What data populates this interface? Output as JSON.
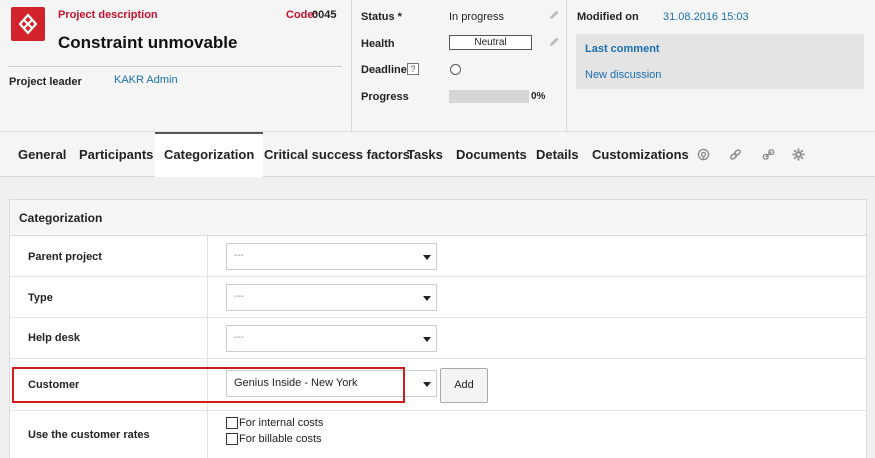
{
  "project": {
    "description_label": "Project description",
    "code_label": "Code:",
    "code_value": "0045",
    "title": "Constraint unmovable",
    "leader_label": "Project leader",
    "leader_value": "KAKR Admin"
  },
  "status": {
    "status_label": "Status *",
    "status_value": "In progress",
    "health_label": "Health",
    "health_value": "Neutral",
    "deadline_label": "Deadline",
    "deadline_help": "?",
    "progress_label": "Progress",
    "progress_value": "0%",
    "progress_fraction": 0
  },
  "meta": {
    "modified_label": "Modified on",
    "modified_value": "31.08.2016 15:03",
    "last_comment_label": "Last comment",
    "new_discussion_label": "New discussion"
  },
  "tabs": {
    "general": "General",
    "participants": "Participants",
    "categorization": "Categorization",
    "critical": "Critical success factors",
    "tasks": "Tasks",
    "documents": "Documents",
    "details": "Details",
    "customizations": "Customizations",
    "active": "Categorization",
    "icons": [
      "broadcast-icon",
      "link-icon",
      "attachment-link-icon",
      "gear-icon"
    ]
  },
  "panel": {
    "title": "Categorization",
    "parent_project_label": "Parent project",
    "parent_project_value": "---",
    "type_label": "Type",
    "type_value": "---",
    "help_desk_label": "Help desk",
    "help_desk_value": "---",
    "customer_label": "Customer",
    "customer_value": "Genius Inside - New York",
    "add_button": "Add",
    "rates_label": "Use the customer rates",
    "internal_costs_label": "For internal costs",
    "billable_costs_label": "For billable costs"
  },
  "colors": {
    "brand_red": "#d2232a",
    "link_blue": "#1a6fb3",
    "highlight_red": "#d41a1a"
  }
}
